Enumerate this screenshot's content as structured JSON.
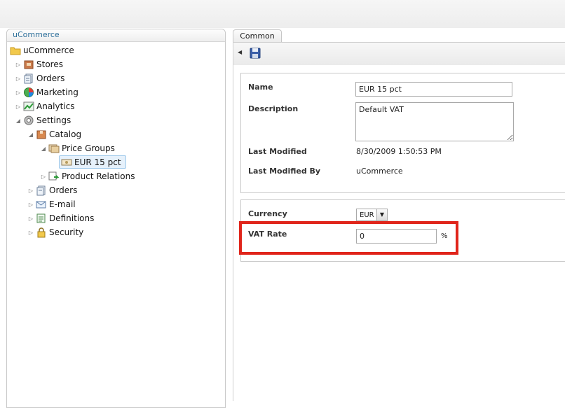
{
  "tree": {
    "header": "uCommerce",
    "items": [
      {
        "label": "uCommerce",
        "icon": "folder-icon"
      },
      {
        "label": "Stores",
        "icon": "store-icon"
      },
      {
        "label": "Orders",
        "icon": "orders-icon"
      },
      {
        "label": "Marketing",
        "icon": "marketing-icon"
      },
      {
        "label": "Analytics",
        "icon": "analytics-icon"
      },
      {
        "label": "Settings",
        "icon": "settings-icon"
      },
      {
        "label": "Catalog",
        "icon": "catalog-icon"
      },
      {
        "label": "Price Groups",
        "icon": "price-groups-icon"
      },
      {
        "label": "EUR 15 pct",
        "icon": "price-group-icon"
      },
      {
        "label": "Product Relations",
        "icon": "product-relations-icon"
      },
      {
        "label": "Orders",
        "icon": "orders-icon"
      },
      {
        "label": "E-mail",
        "icon": "email-icon"
      },
      {
        "label": "Definitions",
        "icon": "definitions-icon"
      },
      {
        "label": "Security",
        "icon": "security-icon"
      }
    ]
  },
  "tabs": {
    "common": "Common"
  },
  "form": {
    "name_label": "Name",
    "name_value": "EUR 15 pct",
    "description_label": "Description",
    "description_value": "Default VAT",
    "last_modified_label": "Last Modified",
    "last_modified_value": "8/30/2009 1:50:53 PM",
    "last_modified_by_label": "Last Modified By",
    "last_modified_by_value": "uCommerce",
    "currency_label": "Currency",
    "currency_value": "EUR",
    "vat_rate_label": "VAT Rate",
    "vat_rate_value": "0",
    "vat_rate_unit": "%"
  },
  "colors": {
    "highlight": "#e0251b",
    "tree_header_text": "#2d6f9a"
  }
}
